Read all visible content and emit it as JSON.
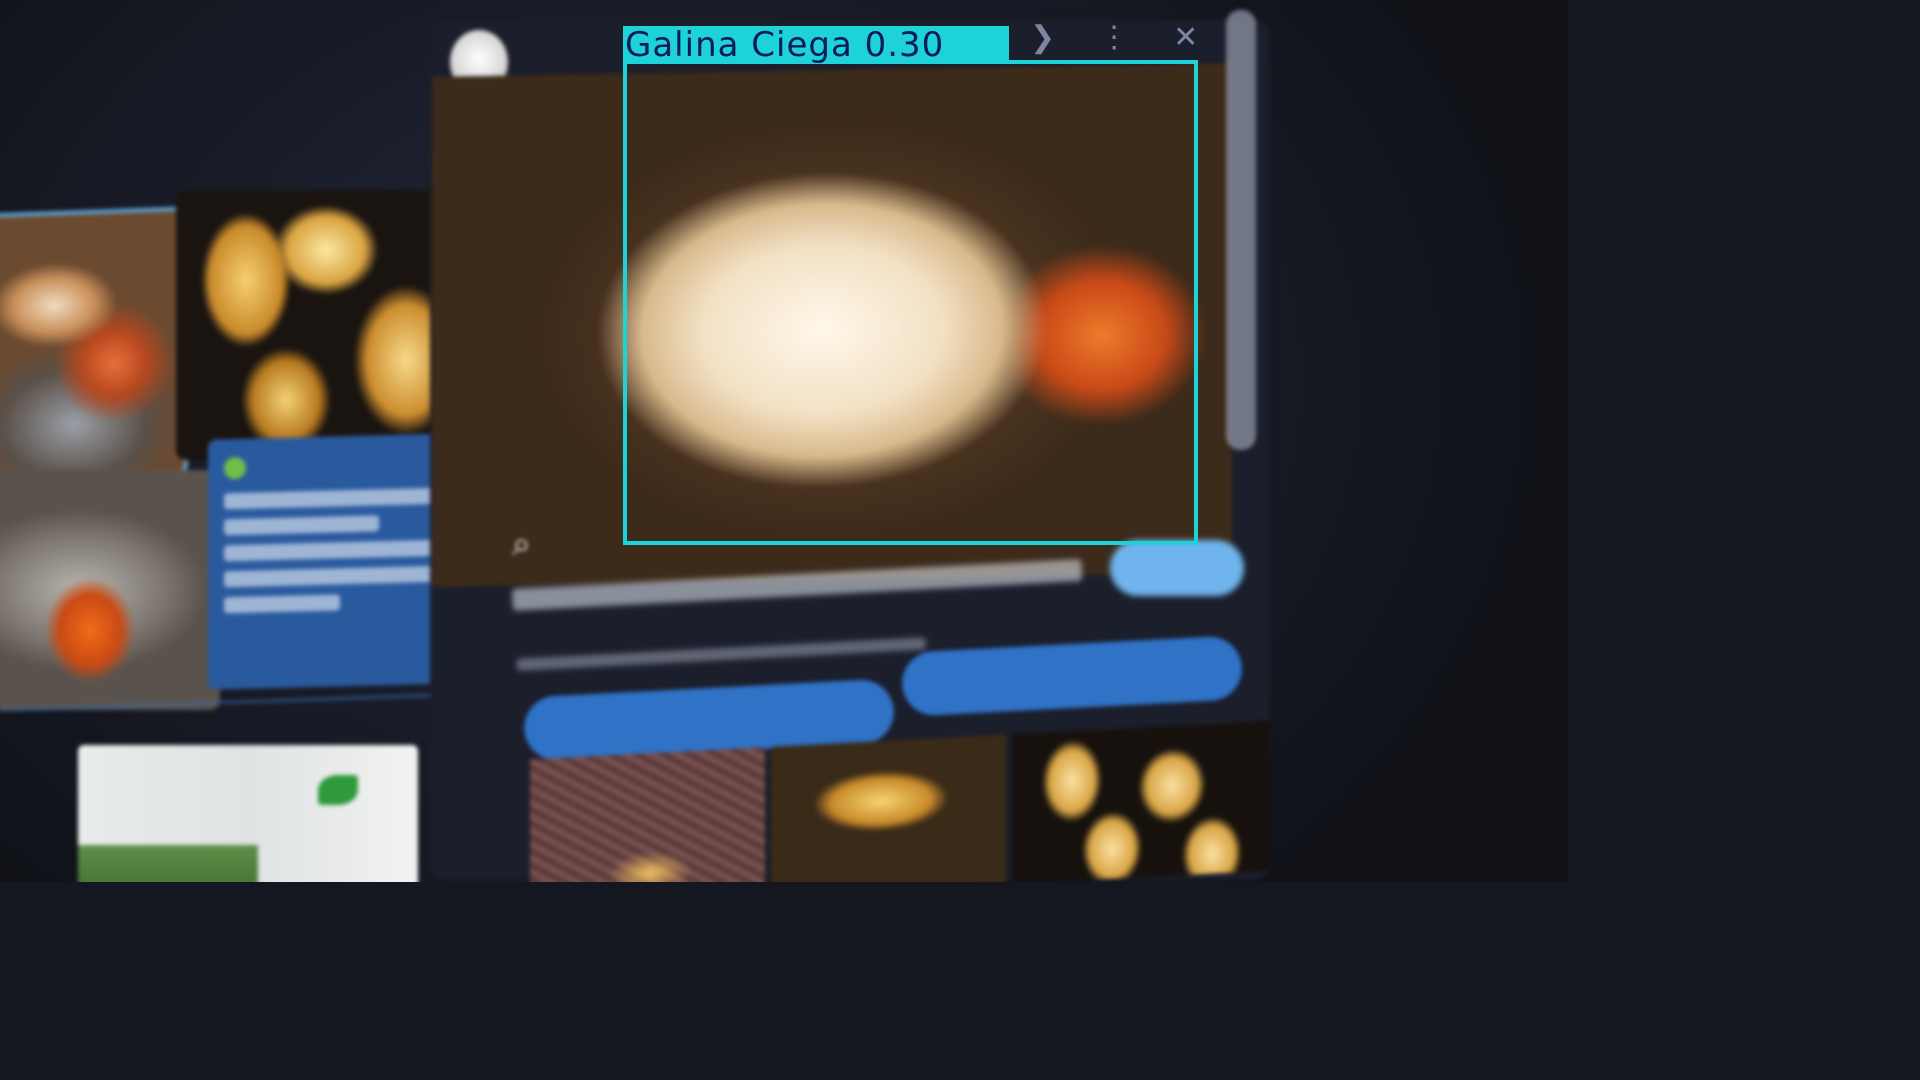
{
  "detection": {
    "label": "Galina Ciega 0.30",
    "box_color": "#1ed3d8",
    "text_color": "#0a1a5a"
  },
  "viewer": {
    "header_icons": [
      "share-icon",
      "more-icon",
      "close-icon"
    ],
    "share_glyph": "❯",
    "more_glyph": "⋮",
    "close_glyph": "✕",
    "lens_glyph": "⌕"
  },
  "colors": {
    "card_blue": "#2a5a9e",
    "button_blue": "#2f72c6",
    "visit_button": "#6fb4ec",
    "background": "#141620"
  }
}
